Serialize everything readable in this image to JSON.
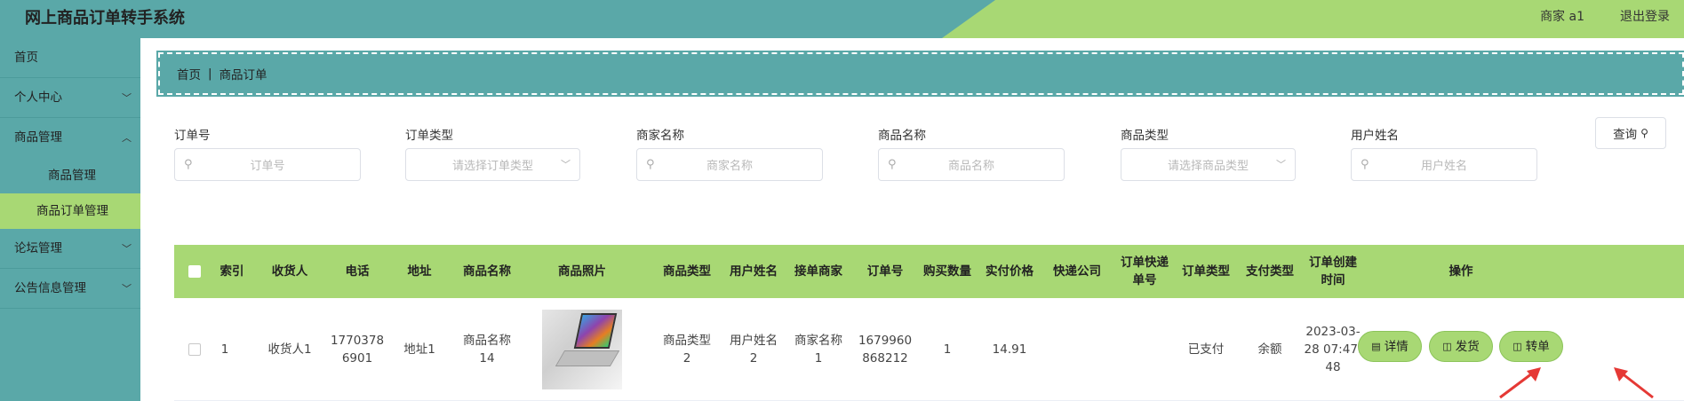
{
  "header": {
    "title": "网上商品订单转手系统",
    "user": "商家 a1",
    "logout": "退出登录"
  },
  "sidebar": {
    "items": [
      {
        "label": "首页"
      },
      {
        "label": "个人中心"
      },
      {
        "label": "商品管理"
      },
      {
        "label": "商品管理"
      },
      {
        "label": "商品订单管理"
      },
      {
        "label": "论坛管理"
      },
      {
        "label": "公告信息管理"
      }
    ]
  },
  "breadcrumb": {
    "home": "首页",
    "sep": "|",
    "current": "商品订单"
  },
  "filters": {
    "order_no": {
      "label": "订单号",
      "placeholder": "订单号"
    },
    "order_type": {
      "label": "订单类型",
      "placeholder": "请选择订单类型"
    },
    "merchant_name": {
      "label": "商家名称",
      "placeholder": "商家名称"
    },
    "product_name": {
      "label": "商品名称",
      "placeholder": "商品名称"
    },
    "product_type": {
      "label": "商品类型",
      "placeholder": "请选择商品类型"
    },
    "user_name": {
      "label": "用户姓名",
      "placeholder": "用户姓名"
    },
    "query_label": "查询"
  },
  "table": {
    "headers": [
      "索引",
      "收货人",
      "电话",
      "地址",
      "商品名称",
      "商品照片",
      "商品类型",
      "用户姓名",
      "接单商家",
      "订单号",
      "购买数量",
      "实付价格",
      "快递公司",
      "订单快递单号",
      "订单类型",
      "支付类型",
      "订单创建时间",
      "操作"
    ],
    "header_lines": {
      "express_no": [
        "订单快递",
        "单号"
      ],
      "created": [
        "订单创建",
        "时间"
      ]
    },
    "rows": [
      {
        "index": "1",
        "receiver": "收货人1",
        "phone_l1": "1770378",
        "phone_l2": "6901",
        "address": "地址1",
        "product_l1": "商品名称",
        "product_l2": "14",
        "type_l1": "商品类型",
        "type_l2": "2",
        "user_l1": "用户姓名",
        "user_l2": "2",
        "merchant_l1": "商家名称",
        "merchant_l2": "1",
        "order_l1": "1679960",
        "order_l2": "868212",
        "qty": "1",
        "price": "14.91",
        "express": "",
        "express_no": "",
        "order_type": "已支付",
        "pay_type": "余额",
        "created_l1": "2023-03-",
        "created_l2": "28 07:47:",
        "created_l3": "48",
        "actions": {
          "detail": "详情",
          "ship": "发货",
          "transfer": "转单"
        }
      }
    ]
  },
  "icons": {
    "search": "search-icon",
    "chevron": "chevron-down-icon",
    "arrow": "red-arrow-icon"
  },
  "colors": {
    "teal": "#5aa8a8",
    "green": "#a8d874",
    "arrow": "#e53935"
  }
}
